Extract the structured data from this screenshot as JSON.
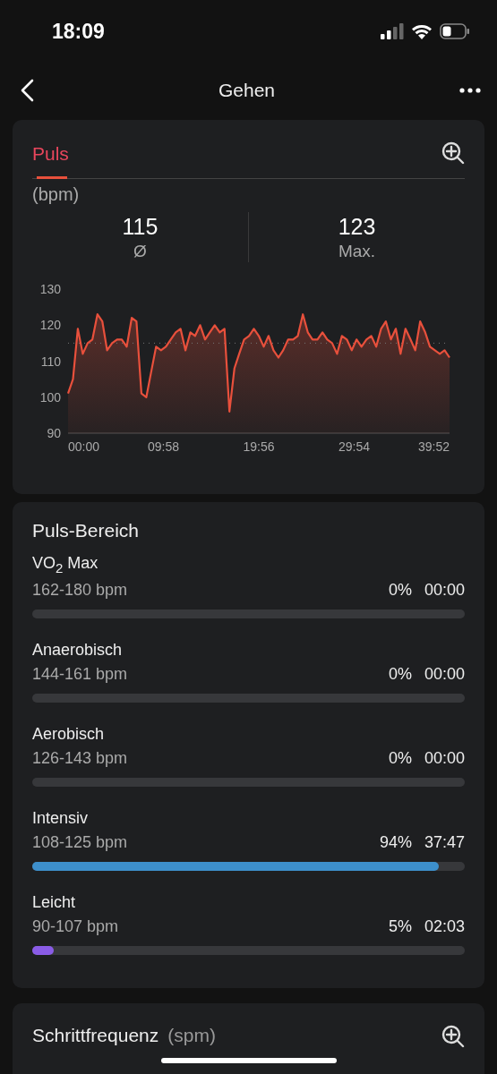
{
  "status_bar": {
    "time": "18:09"
  },
  "nav": {
    "title": "Gehen"
  },
  "pulse_card": {
    "tab": {
      "label": "Puls",
      "selected": true
    },
    "unit": "(bpm)",
    "stats": [
      {
        "value": "115",
        "label": "Ø"
      },
      {
        "value": "123",
        "label": "Max."
      }
    ],
    "chart_data": {
      "type": "area",
      "ylim": [
        90,
        130
      ],
      "yticks": [
        90,
        100,
        110,
        120,
        130
      ],
      "xlim": [
        0,
        2392
      ],
      "xticks": [
        {
          "value": 0,
          "label": "00:00"
        },
        {
          "value": 598,
          "label": "09:58"
        },
        {
          "value": 1196,
          "label": "19:56"
        },
        {
          "value": 1794,
          "label": "29:54"
        },
        {
          "value": 2392,
          "label": "39:52"
        }
      ],
      "ref_lines": [
        {
          "axis": "y",
          "value": 115,
          "color": "#777777"
        }
      ],
      "x": [
        0,
        31,
        61,
        92,
        123,
        153,
        184,
        215,
        245,
        276,
        307,
        337,
        368,
        399,
        429,
        460,
        491,
        521,
        552,
        583,
        613,
        644,
        675,
        705,
        736,
        767,
        797,
        828,
        859,
        889,
        920,
        951,
        981,
        1012,
        1043,
        1073,
        1104,
        1135,
        1165,
        1196,
        1227,
        1257,
        1288,
        1319,
        1349,
        1380,
        1411,
        1441,
        1472,
        1503,
        1533,
        1564,
        1595,
        1625,
        1656,
        1687,
        1717,
        1748,
        1779,
        1809,
        1840,
        1871,
        1901,
        1932,
        1963,
        1993,
        2024,
        2055,
        2085,
        2116,
        2147,
        2177,
        2208,
        2239,
        2269,
        2300,
        2331,
        2361,
        2392
      ],
      "series": [
        {
          "color": "#e8503c",
          "values": [
            101,
            105,
            119,
            112,
            115,
            116,
            123,
            121,
            113,
            115,
            116,
            116,
            114,
            122,
            121,
            101,
            100,
            107,
            114,
            113,
            114,
            116,
            118,
            119,
            113,
            118,
            117,
            120,
            116,
            118,
            120,
            118,
            119,
            96,
            108,
            112,
            116,
            117,
            119,
            117,
            114,
            117,
            113,
            111,
            113,
            116,
            116,
            117,
            123,
            118,
            116,
            116,
            118,
            116,
            115,
            112,
            117,
            116,
            113,
            116,
            114,
            116,
            117,
            114,
            119,
            121,
            116,
            119,
            112,
            119,
            116,
            113,
            121,
            118,
            114,
            113,
            112,
            113,
            111
          ]
        }
      ]
    }
  },
  "zones_card": {
    "title": "Puls-Bereich",
    "zones": [
      {
        "name": "VO$_{2}$ Max",
        "range": "162-180 bpm",
        "percent": "0%",
        "time": "00:00"
      },
      {
        "name": "Anaerobisch",
        "range": "144-161 bpm",
        "percent": "0%",
        "time": "00:00"
      },
      {
        "name": "Aerobisch",
        "range": "126-143 bpm",
        "percent": "0%",
        "time": "00:00"
      },
      {
        "name": "Intensiv",
        "range": "108-125 bpm",
        "percent": "94%",
        "time": "37:47",
        "level": 0.94,
        "color": "#3d8fcb"
      },
      {
        "name": "Leicht",
        "range": "90-107 bpm",
        "percent": "5%",
        "time": "02:03",
        "level": 0.05,
        "color": "#8a5ce6"
      }
    ]
  },
  "cadence_card": {
    "title": "Schrittfrequenz",
    "unit": "(spm)"
  }
}
